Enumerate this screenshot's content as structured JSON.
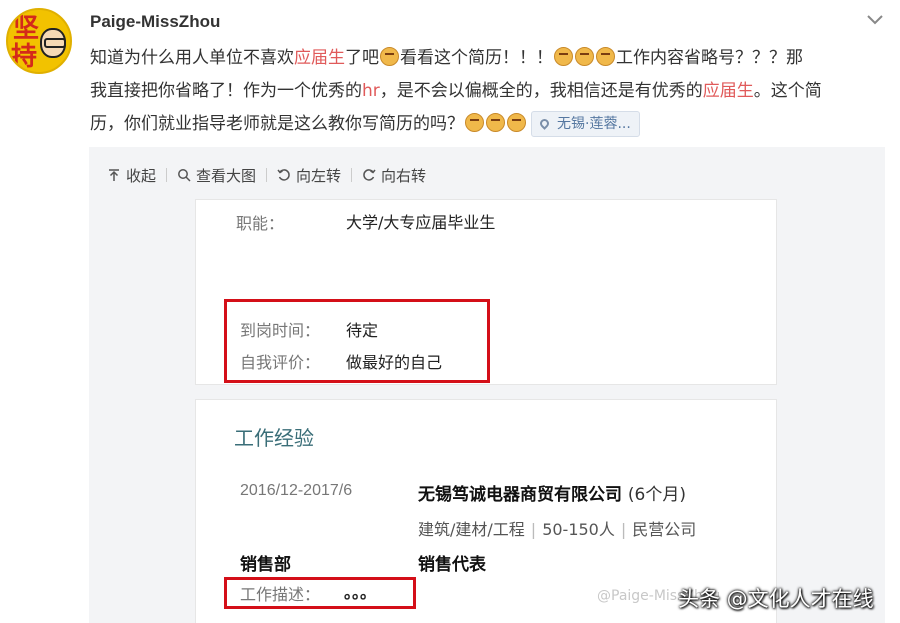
{
  "post": {
    "username": "Paige-MissZhou",
    "avatar_text": [
      "坚",
      "持"
    ],
    "lines": {
      "l1_a": "知道为什么用人单位不喜欢",
      "l1_hl": "应届生",
      "l1_b": "了吧",
      "l1_c": "看看这个简历！！！",
      "l1_d": "工作内容省略号？？？那",
      "l2_a": "我直接把你省略了！作为一个优秀的",
      "l2_hl1": "hr",
      "l2_b": "，是不会以偏概全的，我相信还是有优秀的",
      "l2_hl2": "应届生",
      "l2_c": "。这个简",
      "l3_a": "历，你们就业指导老师就是这么教你写简历的吗？"
    },
    "location": "无锡·莲蓉..."
  },
  "toolbar": {
    "collapse": "收起",
    "view_large": "查看大图",
    "rotate_left": "向左转",
    "rotate_right": "向右转"
  },
  "resume": {
    "function_label": "职能：",
    "function_value": "大学/大专应届毕业生",
    "arrival_label": "到岗时间：",
    "arrival_value": "待定",
    "self_eval_label": "自我评价：",
    "self_eval_value": "做最好的自己",
    "work_title": "工作经验",
    "date_range": "2016/12-2017/6",
    "company": "无锡笃诚电器商贸有限公司",
    "duration": "(6个月)",
    "industry": "建筑/建材/工程",
    "size": "50-150人",
    "ownership": "民营公司",
    "department": "销售部",
    "role": "销售代表",
    "desc_label": "工作描述：",
    "desc_value": "。。。"
  },
  "overlay": {
    "watermark": "@Paige-MissZhou",
    "caption": "头条 @文化人才在线"
  },
  "colors": {
    "highlight": "#e05a5a",
    "red_box": "#d40f18",
    "section_title": "#3a6e78",
    "viewer_bg": "#f3f4f6"
  },
  "icons": [
    "chevron-down-icon",
    "collapse-arrow-icon",
    "magnifier-icon",
    "rotate-left-icon",
    "rotate-right-icon",
    "location-pin-icon",
    "emoji-icon"
  ]
}
